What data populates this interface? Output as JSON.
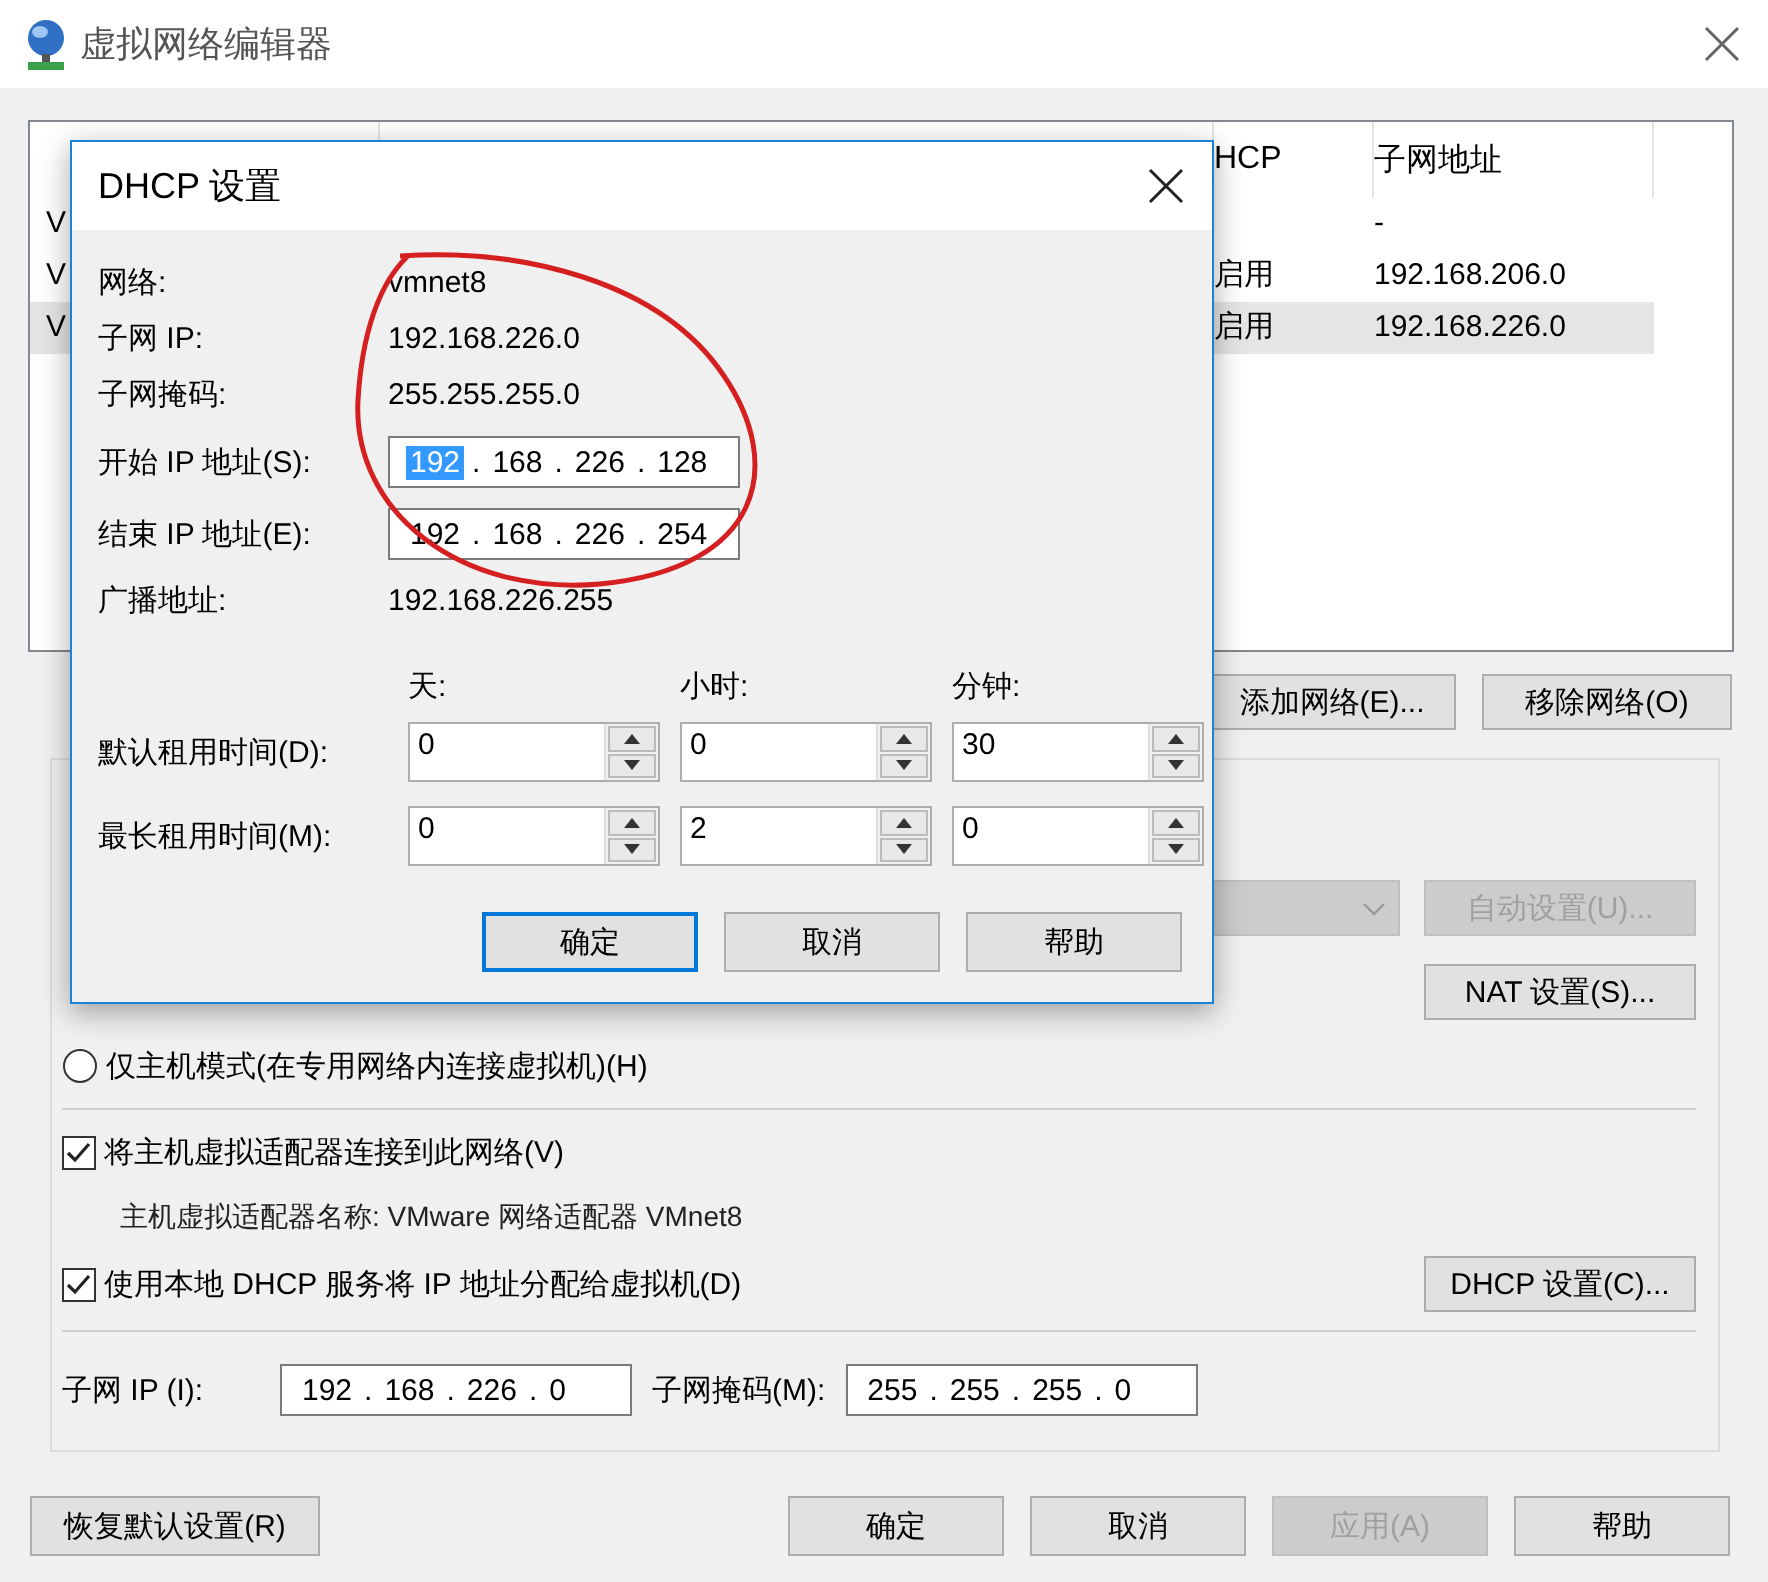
{
  "window": {
    "title": "虚拟网络编辑器"
  },
  "network_table": {
    "dhcp_header": "HCP",
    "subnet_header": "子网地址",
    "rows": [
      {
        "column_1": "V",
        "subnet": "-",
        "selected": false
      },
      {
        "column_1": "V",
        "dhcp": "启用",
        "subnet": "192.168.206.0",
        "selected": false
      },
      {
        "column_1": "V",
        "dhcp": "启用",
        "subnet": "192.168.226.0",
        "selected": true
      }
    ]
  },
  "table_buttons": [
    {
      "label": "添加网络(E)..."
    },
    {
      "label": "移除网络(O)"
    }
  ],
  "settings": {
    "combo_disabled": true,
    "auto_button": {
      "label": "自动设置(U)...",
      "disabled": true
    },
    "nat_button": {
      "label": "NAT 设置(S)...",
      "disabled": false
    },
    "host_only": {
      "label": "仅主机模式(在专用网络内连接虚拟机)(H)",
      "selected": false
    },
    "connect_adapter": {
      "label": "将主机虚拟适配器连接到此网络(V)",
      "checked": true
    },
    "adapter_name": "主机虚拟适配器名称: VMware 网络适配器 VMnet8",
    "use_dhcp": {
      "label": "使用本地 DHCP 服务将 IP 地址分配给虚拟机(D)",
      "checked": true
    },
    "dhcp_button": {
      "label": "DHCP 设置(C)..."
    },
    "subnet_ip": {
      "label": "子网 IP (I):",
      "separator": ".",
      "octets": [
        {
          "text": "192",
          "selected": false
        },
        {
          "text": "168",
          "selected": false
        },
        {
          "text": "226",
          "selected": false
        },
        {
          "text": "0",
          "selected": false
        }
      ]
    },
    "subnet_mask": {
      "label": "子网掩码(M):",
      "separator": ".",
      "octets": [
        {
          "text": "255",
          "selected": false
        },
        {
          "text": "255",
          "selected": false
        },
        {
          "text": "255",
          "selected": false
        },
        {
          "text": "0",
          "selected": false
        }
      ]
    }
  },
  "bottom_buttons": [
    {
      "label": "恢复默认设置(R)",
      "disabled": false
    },
    {
      "label": "确定",
      "disabled": false
    },
    {
      "label": "取消",
      "disabled": false
    },
    {
      "label": "应用(A)",
      "disabled": true
    },
    {
      "label": "帮助",
      "disabled": false
    }
  ],
  "dhcp_dialog": {
    "title": "DHCP 设置",
    "info": [
      {
        "label": "网络:",
        "value": "vmnet8"
      },
      {
        "label": "子网 IP:",
        "value": "192.168.226.0"
      },
      {
        "label": "子网掩码:",
        "value": "255.255.255.0"
      }
    ],
    "ranges": [
      {
        "label": "开始 IP 地址(S):",
        "separator": ".",
        "octets": [
          {
            "text": "192",
            "selected": true
          },
          {
            "text": "168",
            "selected": false
          },
          {
            "text": "226",
            "selected": false
          },
          {
            "text": "128",
            "selected": false
          }
        ]
      },
      {
        "label": "结束 IP 地址(E):",
        "separator": ".",
        "octets": [
          {
            "text": "192",
            "selected": false
          },
          {
            "text": "168",
            "selected": false
          },
          {
            "text": "226",
            "selected": false
          },
          {
            "text": "254",
            "selected": false
          }
        ]
      }
    ],
    "broadcast": {
      "label": "广播地址:",
      "value": "192.168.226.255"
    },
    "lease_headers": [
      "天:",
      "小时:",
      "分钟:"
    ],
    "leases": [
      {
        "label": "默认租用时间(D):",
        "values": [
          "0",
          "0",
          "30"
        ]
      },
      {
        "label": "最长租用时间(M):",
        "values": [
          "0",
          "2",
          "0"
        ]
      }
    ],
    "buttons": [
      {
        "label": "确定",
        "focused": true
      },
      {
        "label": "取消",
        "focused": false
      },
      {
        "label": "帮助",
        "focused": false
      }
    ]
  }
}
